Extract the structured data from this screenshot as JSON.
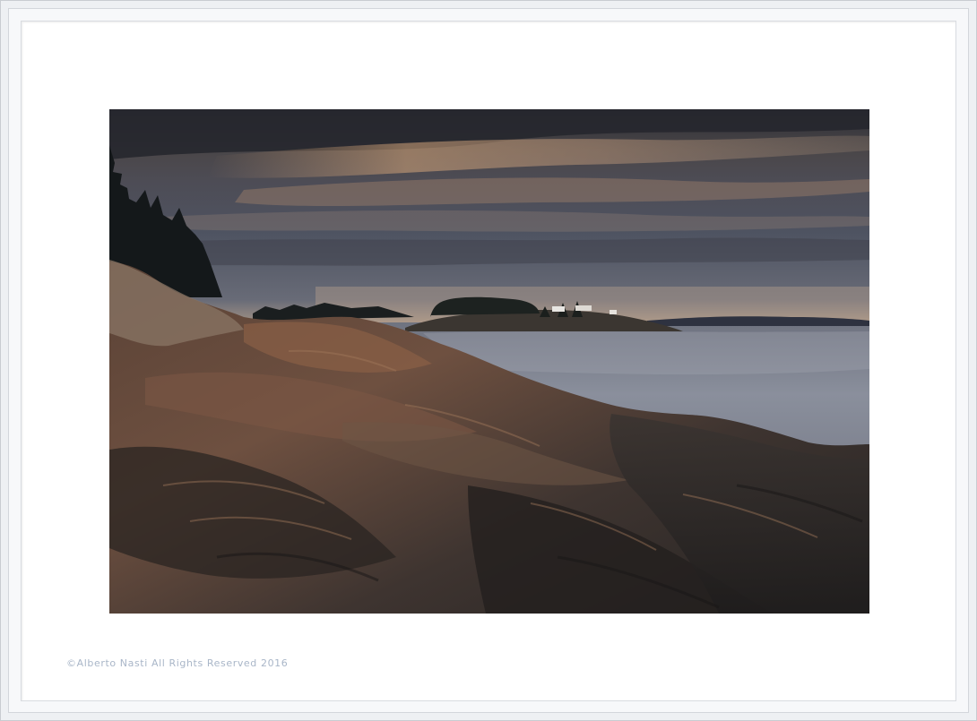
{
  "caption": {
    "copyright": "©Alberto Nasti All Rights Reserved 2016"
  },
  "colors": {
    "frame": "#eef0f3",
    "mat": "#ffffff",
    "caption": "#a9b6c8"
  }
}
